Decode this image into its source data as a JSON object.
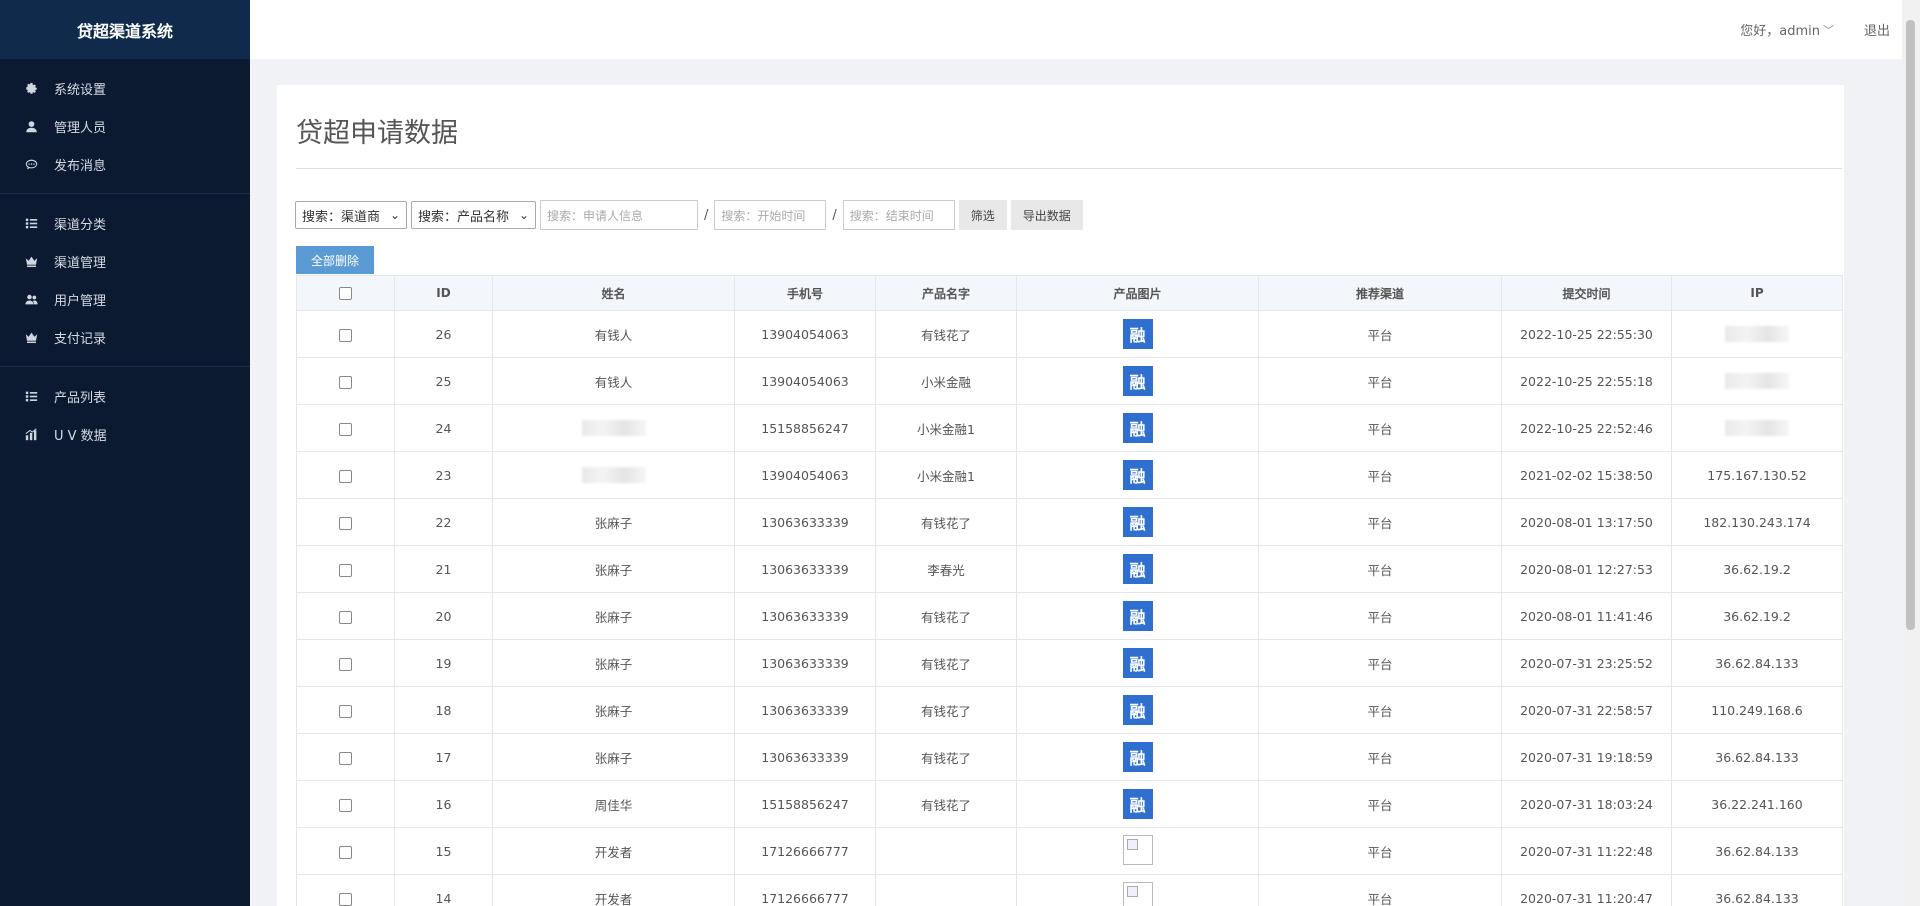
{
  "brand": "贷超渠道系统",
  "nav_groups": [
    [
      {
        "label": "系统设置",
        "icon": "gear-icon"
      },
      {
        "label": "管理人员",
        "icon": "user-icon"
      },
      {
        "label": "发布消息",
        "icon": "chat-icon"
      }
    ],
    [
      {
        "label": "渠道分类",
        "icon": "list-icon"
      },
      {
        "label": "渠道管理",
        "icon": "crown-icon"
      },
      {
        "label": "用户管理",
        "icon": "users-icon"
      },
      {
        "label": "支付记录",
        "icon": "crown-icon"
      }
    ],
    [
      {
        "label": "产品列表",
        "icon": "list-icon"
      },
      {
        "label": "U V 数据",
        "icon": "bar-chart-icon"
      }
    ]
  ],
  "header": {
    "greeting": "您好，admin",
    "logout": "退出"
  },
  "page_title": "贷超申请数据",
  "filters": {
    "channel_select": "搜索：渠道商",
    "product_select": "搜索：产品名称",
    "applicant_placeholder": "搜索：申请人信息",
    "start_placeholder": "搜索：开始时间",
    "end_placeholder": "搜索：结束时间",
    "separator": "/",
    "filter_button": "筛选",
    "export_button": "导出数据"
  },
  "delete_all": "全部删除",
  "table": {
    "headers": [
      "",
      "ID",
      "姓名",
      "手机号",
      "产品名字",
      "产品图片",
      "推荐渠道",
      "提交时间",
      "IP"
    ],
    "logo_glyph": "融",
    "rows": [
      {
        "id": "26",
        "name": "有钱人",
        "phone": "13904054063",
        "product": "有钱花了",
        "img": "logo",
        "channel": "平台",
        "time": "2022-10-25 22:55:30",
        "ip": ""
      },
      {
        "id": "25",
        "name": "有钱人",
        "phone": "13904054063",
        "product": "小米金融",
        "img": "logo",
        "channel": "平台",
        "time": "2022-10-25 22:55:18",
        "ip": ""
      },
      {
        "id": "24",
        "name": "",
        "phone": "15158856247",
        "product": "小米金融1",
        "img": "logo",
        "channel": "平台",
        "time": "2022-10-25 22:52:46",
        "ip": ""
      },
      {
        "id": "23",
        "name": "",
        "phone": "13904054063",
        "product": "小米金融1",
        "img": "logo",
        "channel": "平台",
        "time": "2021-02-02 15:38:50",
        "ip": "175.167.130.52"
      },
      {
        "id": "22",
        "name": "张麻子",
        "phone": "13063633339",
        "product": "有钱花了",
        "img": "logo",
        "channel": "平台",
        "time": "2020-08-01 13:17:50",
        "ip": "182.130.243.174"
      },
      {
        "id": "21",
        "name": "张麻子",
        "phone": "13063633339",
        "product": "李春光",
        "img": "logo",
        "channel": "平台",
        "time": "2020-08-01 12:27:53",
        "ip": "36.62.19.2"
      },
      {
        "id": "20",
        "name": "张麻子",
        "phone": "13063633339",
        "product": "有钱花了",
        "img": "logo",
        "channel": "平台",
        "time": "2020-08-01 11:41:46",
        "ip": "36.62.19.2"
      },
      {
        "id": "19",
        "name": "张麻子",
        "phone": "13063633339",
        "product": "有钱花了",
        "img": "logo",
        "channel": "平台",
        "time": "2020-07-31 23:25:52",
        "ip": "36.62.84.133"
      },
      {
        "id": "18",
        "name": "张麻子",
        "phone": "13063633339",
        "product": "有钱花了",
        "img": "logo",
        "channel": "平台",
        "time": "2020-07-31 22:58:57",
        "ip": "110.249.168.6"
      },
      {
        "id": "17",
        "name": "张麻子",
        "phone": "13063633339",
        "product": "有钱花了",
        "img": "logo",
        "channel": "平台",
        "time": "2020-07-31 19:18:59",
        "ip": "36.62.84.133"
      },
      {
        "id": "16",
        "name": "周佳华",
        "phone": "15158856247",
        "product": "有钱花了",
        "img": "logo",
        "channel": "平台",
        "time": "2020-07-31 18:03:24",
        "ip": "36.22.241.160"
      },
      {
        "id": "15",
        "name": "开发者",
        "phone": "17126666777",
        "product": "",
        "img": "broken",
        "channel": "平台",
        "time": "2020-07-31 11:22:48",
        "ip": "36.62.84.133"
      },
      {
        "id": "14",
        "name": "开发者",
        "phone": "17126666777",
        "product": "",
        "img": "broken",
        "channel": "平台",
        "time": "2020-07-31 11:20:47",
        "ip": "36.62.84.133"
      }
    ]
  },
  "colors": {
    "sidebar": "#0b1a31",
    "brand_bar": "#0f2a4a",
    "accent": "#5b9bd5",
    "logo": "#2f6fcf"
  }
}
